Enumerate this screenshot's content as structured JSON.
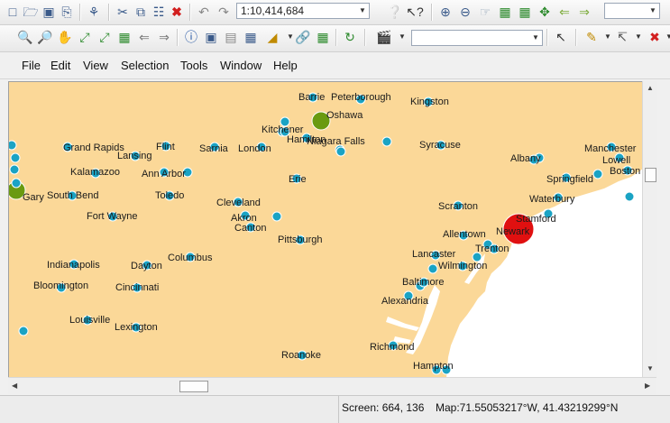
{
  "toolbar1": {
    "scale": "1:10,414,684",
    "right_combo": ""
  },
  "toolbar2": {
    "layer_combo": ""
  },
  "menu": [
    "File",
    "Edit",
    "View",
    "Selection",
    "Tools",
    "Window",
    "Help"
  ],
  "map": {
    "land_color": "#fbd898",
    "water_color": "#ffffff",
    "point_color": "#1aa3c4",
    "cities": [
      "Barrie",
      "Peterborough",
      "Kingston",
      "Oshawa",
      "Kitchener",
      "Hamilton",
      "Niagara Falls",
      "Grand Rapids",
      "Lansing",
      "Flint",
      "Sarnia",
      "London",
      "Syracuse",
      "Manchester",
      "Lowell",
      "Boston",
      "Albany",
      "Springfield",
      "Kalamazoo",
      "Ann Arbor",
      "Erie",
      "Gary",
      "South Bend",
      "Toledo",
      "Waterbury",
      "Cleveland",
      "Scranton",
      "Stamford",
      "Fort Wayne",
      "Akron",
      "Canton",
      "Newark",
      "Allentown",
      "Pittsburgh",
      "Trenton",
      "Lancaster",
      "Indianapolis",
      "Dayton",
      "Columbus",
      "Wilmington",
      "Baltimore",
      "Bloomington",
      "Cincinnati",
      "Alexandria",
      "Louisville",
      "Lexington",
      "Richmond",
      "Roanoke",
      "Hampton"
    ]
  },
  "status": {
    "screen": "Screen: 664, 136",
    "map": "Map:71.55053217°W, 41.43219299°N"
  }
}
